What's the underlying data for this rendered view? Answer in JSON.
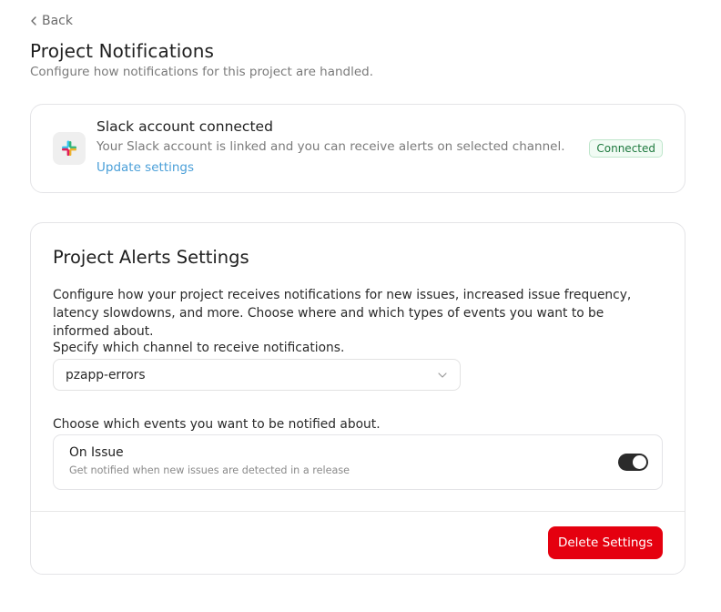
{
  "nav": {
    "back_label": "Back"
  },
  "header": {
    "title": "Project Notifications",
    "subtitle": "Configure how notifications for this project are handled."
  },
  "slack": {
    "title": "Slack account connected",
    "description": "Your Slack account is linked and you can receive alerts on selected channel.",
    "link_label": "Update settings",
    "status_badge": "Connected",
    "logo_icon": "slack-logo-icon"
  },
  "alerts": {
    "title": "Project Alerts Settings",
    "description": "Configure how your project receives notifications for new issues, increased issue frequency, latency slowdowns, and more. Choose where and which types of events you want to be informed about.",
    "channel_label": "Specify which channel to receive notifications.",
    "channel_value": "pzapp-errors",
    "events_label": "Choose which events you want to be notified about.",
    "events": [
      {
        "title": "On Issue",
        "description": "Get notified when new issues are detected in a release",
        "enabled": true
      }
    ],
    "delete_label": "Delete Settings"
  },
  "colors": {
    "accent_link": "#4a9fd8",
    "danger": "#e5000f",
    "success_text": "#1f7a3f",
    "toggle_on": "#2b2b2b"
  }
}
